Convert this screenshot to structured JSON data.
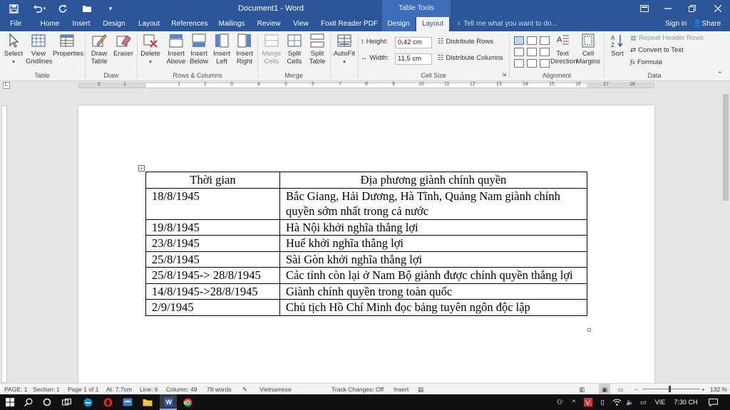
{
  "window": {
    "title": "Document1 - Word",
    "context_tab_group": "Table Tools"
  },
  "tabs": [
    {
      "label": "File"
    },
    {
      "label": "Home"
    },
    {
      "label": "Insert"
    },
    {
      "label": "Design"
    },
    {
      "label": "Layout"
    },
    {
      "label": "References"
    },
    {
      "label": "Mailings"
    },
    {
      "label": "Review"
    },
    {
      "label": "View"
    },
    {
      "label": "Foxit Reader PDF"
    },
    {
      "label": "Design"
    },
    {
      "label": "Layout"
    }
  ],
  "tell_me": "Tell me what you want to do...",
  "sign_in": "Sign in",
  "share": "Share",
  "ribbon": {
    "table": {
      "group": "Table",
      "select": "Select",
      "view_gridlines": "View Gridlines",
      "properties": "Properties"
    },
    "draw": {
      "group": "Draw",
      "draw_table": "Draw Table",
      "eraser": "Eraser"
    },
    "rows_columns": {
      "group": "Rows & Columns",
      "delete": "Delete",
      "insert_above": "Insert Above",
      "insert_below": "Insert Below",
      "insert_left": "Insert Left",
      "insert_right": "Insert Right"
    },
    "merge": {
      "group": "Merge",
      "merge_cells": "Merge Cells",
      "split_cells": "Split Cells",
      "split_table": "Split Table"
    },
    "autofit": "AutoFit",
    "cell_size": {
      "group": "Cell Size",
      "height_label": "Height:",
      "height_value": "0,42 cm",
      "width_label": "Width:",
      "width_value": "11,5 cm",
      "distribute_rows": "Distribute Rows",
      "distribute_columns": "Distribute Columns"
    },
    "alignment": {
      "group": "Alignment",
      "text_direction": "Text Direction",
      "cell_margins": "Cell Margins"
    },
    "data": {
      "group": "Data",
      "sort": "Sort",
      "repeat_header_rows": "Repeat Header Rows",
      "convert_to_text": "Convert to Text",
      "formula": "Formula"
    }
  },
  "ruler_numbers": [
    "2",
    "1",
    "1",
    "2",
    "3",
    "4",
    "5",
    "6",
    "7",
    "8",
    "9",
    "10",
    "11",
    "12",
    "13",
    "14",
    "15",
    "16",
    "17",
    "18"
  ],
  "document_table": {
    "headers": [
      "Thời gian",
      "Địa phương giành chính quyền"
    ],
    "rows": [
      [
        "18/8/1945",
        "Bắc Giang, Hải Dương, Hà Tĩnh, Quảng Nam giành chính quyền sớm nhất trong cả nước"
      ],
      [
        "19/8/1945",
        "Hà Nội khởi nghĩa thắng lợi"
      ],
      [
        "23/8/1945",
        "Huế khởi nghĩa thắng lợi"
      ],
      [
        "25/8/1945",
        "Sài Gòn khởi nghĩa thắng lợi"
      ],
      [
        "25/8/1945-> 28/8/1945",
        "Các tỉnh còn lại ở Nam Bộ giành được chính quyền thắng lợi"
      ],
      [
        "14/8/1945->28/8/1945",
        "Giành chính quyền trong toàn quốc"
      ],
      [
        "2/9/1945",
        "Chủ tịch Hồ Chí Minh đọc bảng tuyên ngôn độc lập"
      ]
    ]
  },
  "status_bar": {
    "page": "PAGE: 1",
    "section": "Section: 1",
    "page_of": "Page 1 of 1",
    "at": "At: 7.7cm",
    "line": "Line: 6",
    "column": "Column: 49",
    "words": "78 words",
    "language": "Vietnamese",
    "track_changes": "Track Changes: Off",
    "insert": "Insert",
    "zoom": "132 %"
  },
  "taskbar": {
    "language": "VIE",
    "time": "7:30 CH"
  },
  "colors": {
    "word_blue": "#2b579a",
    "ribbon_bg": "#f3f3f3",
    "taskbar_bg": "#101010"
  }
}
